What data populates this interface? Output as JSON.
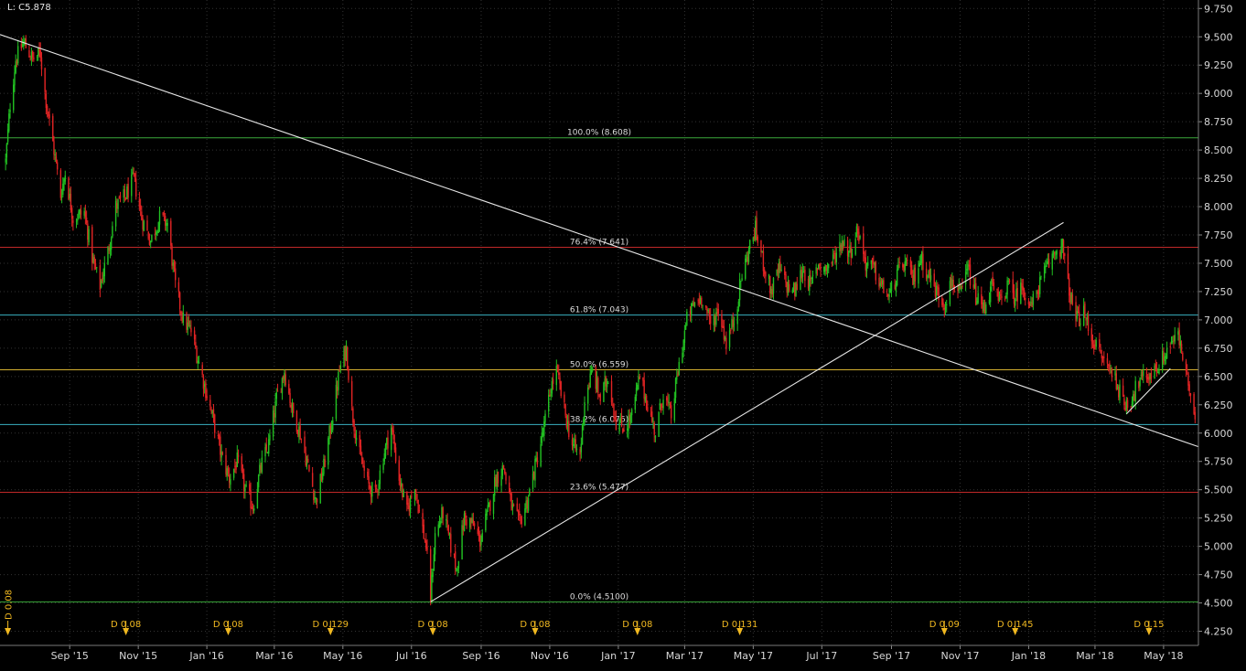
{
  "header": {
    "last_label": "L: C5.878"
  },
  "chart_data": {
    "type": "candlestick",
    "title": "",
    "xlabel": "",
    "ylabel": "",
    "ylim": [
      4.125,
      9.825
    ],
    "y_ticks": [
      "9.750",
      "9.500",
      "9.250",
      "9.000",
      "8.750",
      "8.500",
      "8.250",
      "8.000",
      "7.750",
      "7.500",
      "7.250",
      "7.000",
      "6.750",
      "6.500",
      "6.250",
      "6.000",
      "5.750",
      "5.500",
      "5.250",
      "5.000",
      "4.750",
      "4.500",
      "4.250"
    ],
    "x_tick_labels": [
      "Sep '15",
      "Nov '15",
      "Jan '16",
      "Mar '16",
      "May '16",
      "Jul '16",
      "Sep '16",
      "Nov '16",
      "Jan '17",
      "Mar '17",
      "May '17",
      "Jul '17",
      "Sep '17",
      "Nov '17",
      "Jan '18",
      "Mar '18",
      "May '18"
    ],
    "grid": true,
    "price_path": [
      [
        "2015-07-06",
        8.4
      ],
      [
        "2015-07-10",
        8.9
      ],
      [
        "2015-07-15",
        9.3
      ],
      [
        "2015-07-22",
        9.45
      ],
      [
        "2015-07-30",
        9.3
      ],
      [
        "2015-08-06",
        9.35
      ],
      [
        "2015-08-10",
        9.0
      ],
      [
        "2015-08-18",
        8.5
      ],
      [
        "2015-08-24",
        8.1
      ],
      [
        "2015-08-28",
        8.3
      ],
      [
        "2015-09-04",
        7.9
      ],
      [
        "2015-09-14",
        7.95
      ],
      [
        "2015-09-22",
        7.5
      ],
      [
        "2015-09-28",
        7.3
      ],
      [
        "2015-10-05",
        7.6
      ],
      [
        "2015-10-12",
        8.0
      ],
      [
        "2015-10-21",
        8.1
      ],
      [
        "2015-10-28",
        8.25
      ],
      [
        "2015-11-04",
        7.9
      ],
      [
        "2015-11-12",
        7.7
      ],
      [
        "2015-11-20",
        7.9
      ],
      [
        "2015-11-27",
        7.85
      ],
      [
        "2015-12-04",
        7.3
      ],
      [
        "2015-12-11",
        7.0
      ],
      [
        "2015-12-18",
        6.9
      ],
      [
        "2015-12-28",
        6.5
      ],
      [
        "2016-01-07",
        6.1
      ],
      [
        "2016-01-14",
        5.8
      ],
      [
        "2016-01-21",
        5.6
      ],
      [
        "2016-01-28",
        5.75
      ],
      [
        "2016-02-04",
        5.5
      ],
      [
        "2016-02-11",
        5.35
      ],
      [
        "2016-02-18",
        5.7
      ],
      [
        "2016-02-25",
        5.9
      ],
      [
        "2016-03-03",
        6.3
      ],
      [
        "2016-03-10",
        6.55
      ],
      [
        "2016-03-17",
        6.2
      ],
      [
        "2016-03-24",
        6.0
      ],
      [
        "2016-03-31",
        5.7
      ],
      [
        "2016-04-07",
        5.4
      ],
      [
        "2016-04-14",
        5.7
      ],
      [
        "2016-04-21",
        6.1
      ],
      [
        "2016-04-28",
        6.55
      ],
      [
        "2016-05-04",
        6.75
      ],
      [
        "2016-05-09",
        6.2
      ],
      [
        "2016-05-16",
        5.8
      ],
      [
        "2016-05-23",
        5.55
      ],
      [
        "2016-05-30",
        5.45
      ],
      [
        "2016-06-06",
        5.8
      ],
      [
        "2016-06-13",
        6.05
      ],
      [
        "2016-06-20",
        5.6
      ],
      [
        "2016-06-27",
        5.3
      ],
      [
        "2016-07-04",
        5.55
      ],
      [
        "2016-07-08",
        5.3
      ],
      [
        "2016-07-14",
        5.0
      ],
      [
        "2016-07-18",
        4.55
      ],
      [
        "2016-07-22",
        5.1
      ],
      [
        "2016-07-29",
        5.3
      ],
      [
        "2016-08-05",
        5.0
      ],
      [
        "2016-08-10",
        4.8
      ],
      [
        "2016-08-17",
        5.25
      ],
      [
        "2016-08-24",
        5.2
      ],
      [
        "2016-08-31",
        5.05
      ],
      [
        "2016-09-07",
        5.3
      ],
      [
        "2016-09-14",
        5.6
      ],
      [
        "2016-09-21",
        5.7
      ],
      [
        "2016-09-28",
        5.35
      ],
      [
        "2016-10-05",
        5.2
      ],
      [
        "2016-10-12",
        5.4
      ],
      [
        "2016-10-19",
        5.7
      ],
      [
        "2016-10-26",
        6.0
      ],
      [
        "2016-11-02",
        6.4
      ],
      [
        "2016-11-07",
        6.55
      ],
      [
        "2016-11-14",
        6.2
      ],
      [
        "2016-11-21",
        5.9
      ],
      [
        "2016-11-28",
        5.8
      ],
      [
        "2016-12-02",
        6.3
      ],
      [
        "2016-12-09",
        6.55
      ],
      [
        "2016-12-16",
        6.3
      ],
      [
        "2016-12-23",
        6.5
      ],
      [
        "2016-12-30",
        6.1
      ],
      [
        "2017-01-06",
        6.05
      ],
      [
        "2017-01-13",
        6.15
      ],
      [
        "2017-01-20",
        6.5
      ],
      [
        "2017-01-27",
        6.25
      ],
      [
        "2017-02-03",
        6.0
      ],
      [
        "2017-02-10",
        6.35
      ],
      [
        "2017-02-17",
        6.15
      ],
      [
        "2017-02-24",
        6.6
      ],
      [
        "2017-03-03",
        7.0
      ],
      [
        "2017-03-10",
        7.15
      ],
      [
        "2017-03-17",
        7.2
      ],
      [
        "2017-03-24",
        6.95
      ],
      [
        "2017-03-31",
        7.1
      ],
      [
        "2017-04-07",
        6.8
      ],
      [
        "2017-04-14",
        7.0
      ],
      [
        "2017-04-21",
        7.4
      ],
      [
        "2017-04-28",
        7.65
      ],
      [
        "2017-05-03",
        7.8
      ],
      [
        "2017-05-10",
        7.5
      ],
      [
        "2017-05-17",
        7.25
      ],
      [
        "2017-05-24",
        7.45
      ],
      [
        "2017-05-31",
        7.3
      ],
      [
        "2017-06-07",
        7.25
      ],
      [
        "2017-06-14",
        7.45
      ],
      [
        "2017-06-21",
        7.3
      ],
      [
        "2017-06-28",
        7.5
      ],
      [
        "2017-07-05",
        7.45
      ],
      [
        "2017-07-12",
        7.55
      ],
      [
        "2017-07-19",
        7.7
      ],
      [
        "2017-07-26",
        7.6
      ],
      [
        "2017-08-02",
        7.8
      ],
      [
        "2017-08-09",
        7.5
      ],
      [
        "2017-08-16",
        7.45
      ],
      [
        "2017-08-23",
        7.3
      ],
      [
        "2017-08-30",
        7.2
      ],
      [
        "2017-09-06",
        7.4
      ],
      [
        "2017-09-13",
        7.5
      ],
      [
        "2017-09-20",
        7.35
      ],
      [
        "2017-09-27",
        7.55
      ],
      [
        "2017-10-04",
        7.4
      ],
      [
        "2017-10-11",
        7.25
      ],
      [
        "2017-10-18",
        7.15
      ],
      [
        "2017-10-25",
        7.35
      ],
      [
        "2017-11-01",
        7.2
      ],
      [
        "2017-11-08",
        7.45
      ],
      [
        "2017-11-15",
        7.2
      ],
      [
        "2017-11-22",
        7.1
      ],
      [
        "2017-11-29",
        7.3
      ],
      [
        "2017-12-06",
        7.15
      ],
      [
        "2017-12-13",
        7.3
      ],
      [
        "2017-12-20",
        7.2
      ],
      [
        "2017-12-27",
        7.3
      ],
      [
        "2018-01-03",
        7.1
      ],
      [
        "2018-01-10",
        7.3
      ],
      [
        "2018-01-17",
        7.45
      ],
      [
        "2018-01-24",
        7.6
      ],
      [
        "2018-01-31",
        7.65
      ],
      [
        "2018-02-05",
        7.3
      ],
      [
        "2018-02-12",
        7.0
      ],
      [
        "2018-02-19",
        7.05
      ],
      [
        "2018-02-26",
        6.85
      ],
      [
        "2018-03-05",
        6.7
      ],
      [
        "2018-03-12",
        6.6
      ],
      [
        "2018-03-19",
        6.5
      ],
      [
        "2018-03-26",
        6.25
      ],
      [
        "2018-04-02",
        6.3
      ],
      [
        "2018-04-09",
        6.45
      ],
      [
        "2018-04-16",
        6.5
      ],
      [
        "2018-04-23",
        6.55
      ],
      [
        "2018-04-30",
        6.65
      ],
      [
        "2018-05-07",
        6.8
      ],
      [
        "2018-05-14",
        6.85
      ],
      [
        "2018-05-21",
        6.55
      ],
      [
        "2018-05-25",
        6.3
      ],
      [
        "2018-05-29",
        6.05
      ]
    ],
    "fib_levels": [
      {
        "label": "100.0% (8.608)",
        "value": 8.608,
        "color": "#3aa83a"
      },
      {
        "label": "76.4% (7.641)",
        "value": 7.641,
        "color": "#c02828"
      },
      {
        "label": "61.8% (7.043)",
        "value": 7.043,
        "color": "#3ab0c0"
      },
      {
        "label": "50.0% (6.559)",
        "value": 6.559,
        "color": "#d4b030"
      },
      {
        "label": "38.2% (6.076)",
        "value": 6.076,
        "color": "#3ab0c0"
      },
      {
        "label": "23.6% (5.477)",
        "value": 5.477,
        "color": "#c02828"
      },
      {
        "label": "0.0% (4.5100)",
        "value": 4.51,
        "color": "#3aa83a"
      }
    ],
    "trendlines": [
      {
        "from": [
          "2015-07-01",
          9.52
        ],
        "to": [
          "2018-06-01",
          5.88
        ]
      },
      {
        "from": [
          "2016-07-18",
          4.51
        ],
        "to": [
          "2018-02-01",
          7.86
        ]
      },
      {
        "from": [
          "2018-03-29",
          6.17
        ],
        "to": [
          "2018-05-07",
          6.57
        ]
      }
    ],
    "dividends": [
      {
        "date": "2015-07-08",
        "label": "D 0.08"
      },
      {
        "date": "2015-10-21",
        "label": "D 0.08"
      },
      {
        "date": "2016-01-20",
        "label": "D 0.08"
      },
      {
        "date": "2016-04-20",
        "label": "D 0.129"
      },
      {
        "date": "2016-07-20",
        "label": "D 0.08"
      },
      {
        "date": "2016-10-19",
        "label": "D 0.08"
      },
      {
        "date": "2017-01-18",
        "label": "D 0.08"
      },
      {
        "date": "2017-04-19",
        "label": "D 0.131"
      },
      {
        "date": "2017-10-18",
        "label": "D 0.09"
      },
      {
        "date": "2017-12-20",
        "label": "D 0.145"
      },
      {
        "date": "2018-04-18",
        "label": "D 0.15"
      }
    ],
    "colors": {
      "background": "#000000",
      "up": "#22c022",
      "down": "#e02424",
      "grid": "#333333",
      "axis_text": "#d8d8d8",
      "trendline": "#e6e6e6",
      "dividend": "#f0b820"
    }
  }
}
